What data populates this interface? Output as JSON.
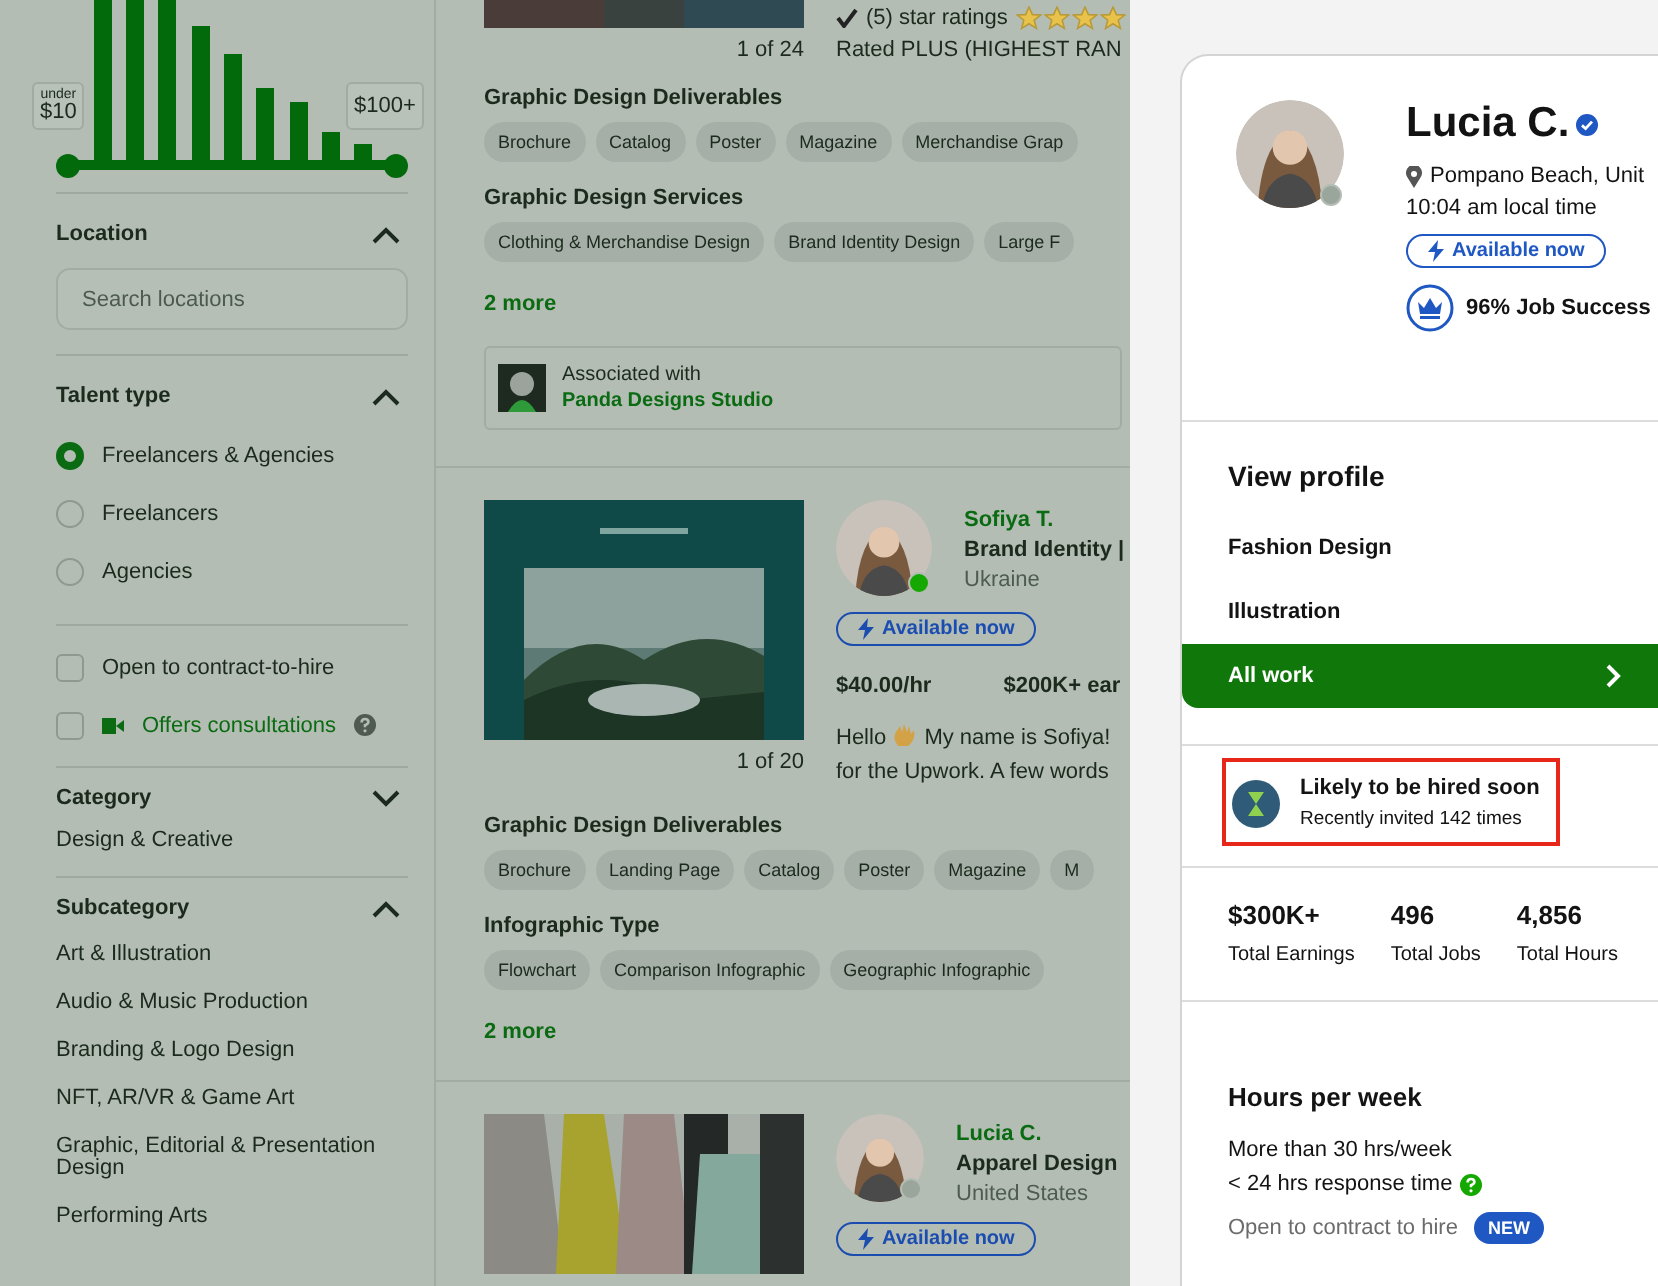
{
  "price_filter": {
    "min_caption": "under",
    "min_value": "$10",
    "max_value": "$100+"
  },
  "location": {
    "title": "Location",
    "expanded": true,
    "placeholder": "Search locations"
  },
  "talent_type": {
    "title": "Talent type",
    "expanded": true,
    "options": [
      {
        "label": "Freelancers & Agencies",
        "selected": true
      },
      {
        "label": "Freelancers",
        "selected": false
      },
      {
        "label": "Agencies",
        "selected": false
      }
    ]
  },
  "checkboxes": [
    {
      "label": "Open to contract-to-hire",
      "checked": false,
      "kind": "plain"
    },
    {
      "label": "Offers consultations",
      "checked": false,
      "kind": "consultation"
    }
  ],
  "category": {
    "title": "Category",
    "expanded": false,
    "value": "Design & Creative"
  },
  "subcategory": {
    "title": "Subcategory",
    "expanded": true,
    "items": [
      "Art & Illustration",
      "Audio & Music Production",
      "Branding & Logo Design",
      "NFT, AR/VR & Game Art",
      "Graphic, Editorial & Presentation Design",
      "Performing Arts"
    ]
  },
  "listings": [
    {
      "gallery_count": "1 of 24",
      "rating_text": "(5) star ratings",
      "stars": 4,
      "rated_text": "Rated PLUS (HIGHEST RAN",
      "skill_groups": [
        {
          "title": "Graphic Design Deliverables",
          "tags": [
            "Brochure",
            "Catalog",
            "Poster",
            "Magazine",
            "Merchandise Grap"
          ]
        },
        {
          "title": "Graphic Design Services",
          "tags": [
            "Clothing & Merchandise Design",
            "Brand Identity Design",
            "Large F"
          ]
        }
      ],
      "more": "2 more",
      "association": {
        "caption": "Associated with",
        "name": "Panda Designs Studio"
      }
    },
    {
      "gallery_count": "1 of 20",
      "name": "Sofiya T.",
      "title": "Brand Identity |",
      "country": "Ukraine",
      "online": true,
      "availability": "Available now",
      "rate": "$40.00/hr",
      "earned": "$200K+ ear",
      "bio": {
        "greeting": "Hello",
        "line_1": "My name is Sofiya!",
        "line_2": "for the Upwork. A few words"
      },
      "skill_groups": [
        {
          "title": "Graphic Design Deliverables",
          "tags": [
            "Brochure",
            "Landing Page",
            "Catalog",
            "Poster",
            "Magazine",
            "M"
          ]
        },
        {
          "title": "Infographic Type",
          "tags": [
            "Flowchart",
            "Comparison Infographic",
            "Geographic Infographic"
          ]
        }
      ],
      "more": "2 more"
    },
    {
      "name": "Lucia C.",
      "title": "Apparel Design",
      "country": "United States",
      "online": false,
      "availability": "Available now"
    }
  ],
  "profile": {
    "name": "Lucia C.",
    "verified": true,
    "location": "Pompano Beach, Unit",
    "local_time": "10:04 am local time",
    "online": false,
    "availability": "Available now",
    "job_success": "96% Job Success",
    "view_profile": "View profile",
    "menu": [
      {
        "label": "Fashion Design",
        "selected": false
      },
      {
        "label": "Illustration",
        "selected": false
      },
      {
        "label": "All work",
        "selected": true
      }
    ],
    "highlight": {
      "title": "Likely to be hired soon",
      "subtitle": "Recently invited 142 times",
      "outlined": true
    },
    "stats": [
      {
        "value": "$300K+",
        "label": "Total Earnings"
      },
      {
        "value": "496",
        "label": "Total Jobs"
      },
      {
        "value": "4,856",
        "label": "Total Hours"
      }
    ],
    "hours": {
      "title": "Hours per week",
      "lines": [
        "More than 30 hrs/week",
        "< 24 hrs response time"
      ],
      "contract": "Open to contract to hire",
      "badge": "NEW"
    }
  }
}
